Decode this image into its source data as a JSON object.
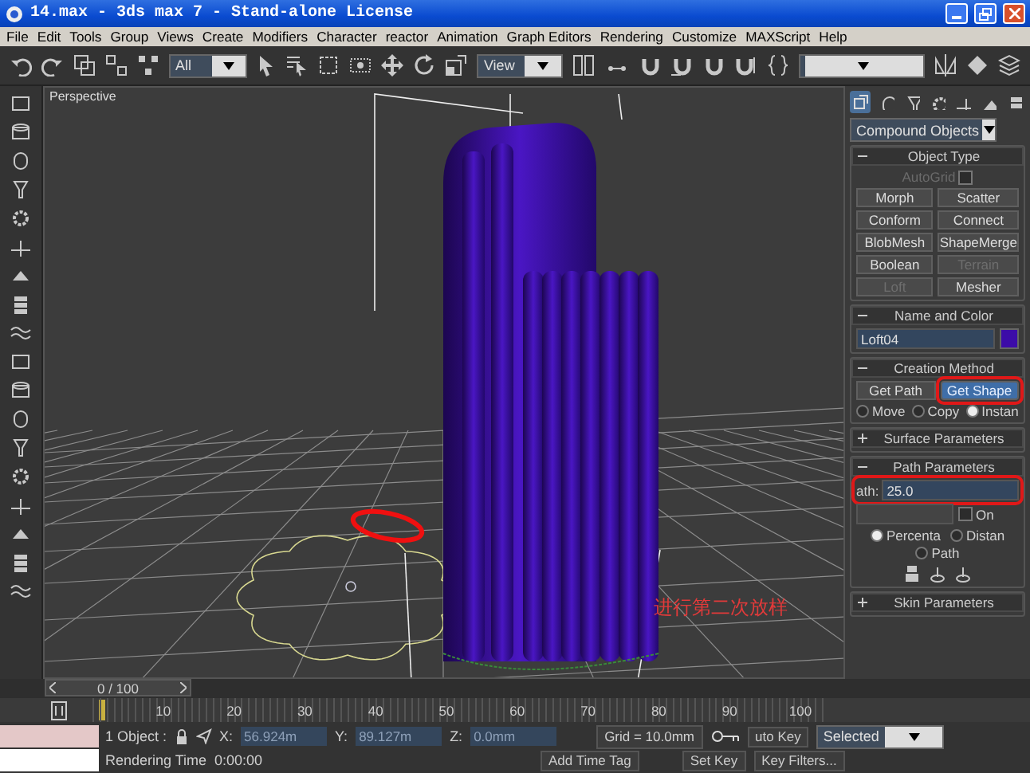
{
  "window": {
    "title": "14.max - 3ds max 7  - Stand-alone License"
  },
  "menu": [
    "File",
    "Edit",
    "Tools",
    "Group",
    "Views",
    "Create",
    "Modifiers",
    "Character",
    "reactor",
    "Animation",
    "Graph Editors",
    "Rendering",
    "Customize",
    "MAXScript",
    "Help"
  ],
  "toolbar": {
    "selection_filter": "All",
    "reference_coord": "View"
  },
  "viewport": {
    "label": "Perspective",
    "annotation": "进行第二次放样"
  },
  "command_panel": {
    "category": "Compound Objects",
    "rollouts": [
      {
        "kind": "object_type",
        "title": "Object Type",
        "expanded": true,
        "autogrid": {
          "label": "AutoGrid",
          "checked": false,
          "disabled": true
        },
        "buttons": [
          {
            "label": "Morph",
            "disabled": false
          },
          {
            "label": "Scatter",
            "disabled": false
          },
          {
            "label": "Conform",
            "disabled": false
          },
          {
            "label": "Connect",
            "disabled": false
          },
          {
            "label": "BlobMesh",
            "disabled": false
          },
          {
            "label": "ShapeMerge",
            "disabled": false
          },
          {
            "label": "Boolean",
            "disabled": false
          },
          {
            "label": "Terrain",
            "disabled": true
          },
          {
            "label": "Loft",
            "disabled": true
          },
          {
            "label": "Mesher",
            "disabled": false
          }
        ]
      },
      {
        "kind": "name_color",
        "title": "Name and Color",
        "expanded": true,
        "name": "Loft04",
        "color": "#3c0ca8"
      },
      {
        "kind": "creation_method",
        "title": "Creation Method",
        "expanded": true,
        "buttons": [
          {
            "label": "Get Path",
            "selected": false,
            "annotated": false
          },
          {
            "label": "Get Shape",
            "selected": true,
            "annotated": true
          }
        ],
        "options": [
          {
            "label": "Move",
            "selected": false
          },
          {
            "label": "Copy",
            "selected": false
          },
          {
            "label": "Instan",
            "selected": true
          }
        ]
      },
      {
        "kind": "header",
        "title": "Surface Parameters",
        "expanded": false
      },
      {
        "kind": "path_parameters",
        "title": "Path Parameters",
        "expanded": true,
        "path_label": "ath:",
        "path_value": "25.0",
        "annotated": true,
        "snap": {
          "label": "On",
          "checked": false
        },
        "options": [
          {
            "label": "Percenta",
            "selected": true
          },
          {
            "label": "Distan",
            "selected": false
          },
          {
            "label": "Path",
            "selected": false
          }
        ]
      },
      {
        "kind": "header",
        "title": "Skin Parameters",
        "expanded": false
      }
    ]
  },
  "time_slider": {
    "position": "0 / 100"
  },
  "trackbar": {
    "ticks": [
      "10",
      "20",
      "30",
      "40",
      "50",
      "60",
      "70",
      "80",
      "90",
      "100"
    ]
  },
  "status": {
    "selection": "1 Object :",
    "x_label": "X:",
    "x_value": "56.924m",
    "y_label": "Y:",
    "y_value": "89.127m",
    "z_label": "Z:",
    "z_value": "0.0mm",
    "grid": "Grid = 10.0mm",
    "auto_key": "uto Key",
    "key_mode": "Selected",
    "prompt": "Rendering Time  0:00:00",
    "time_tag": "Add Time Tag",
    "set_key": "Set Key",
    "key_filters": "Key Filters..."
  }
}
